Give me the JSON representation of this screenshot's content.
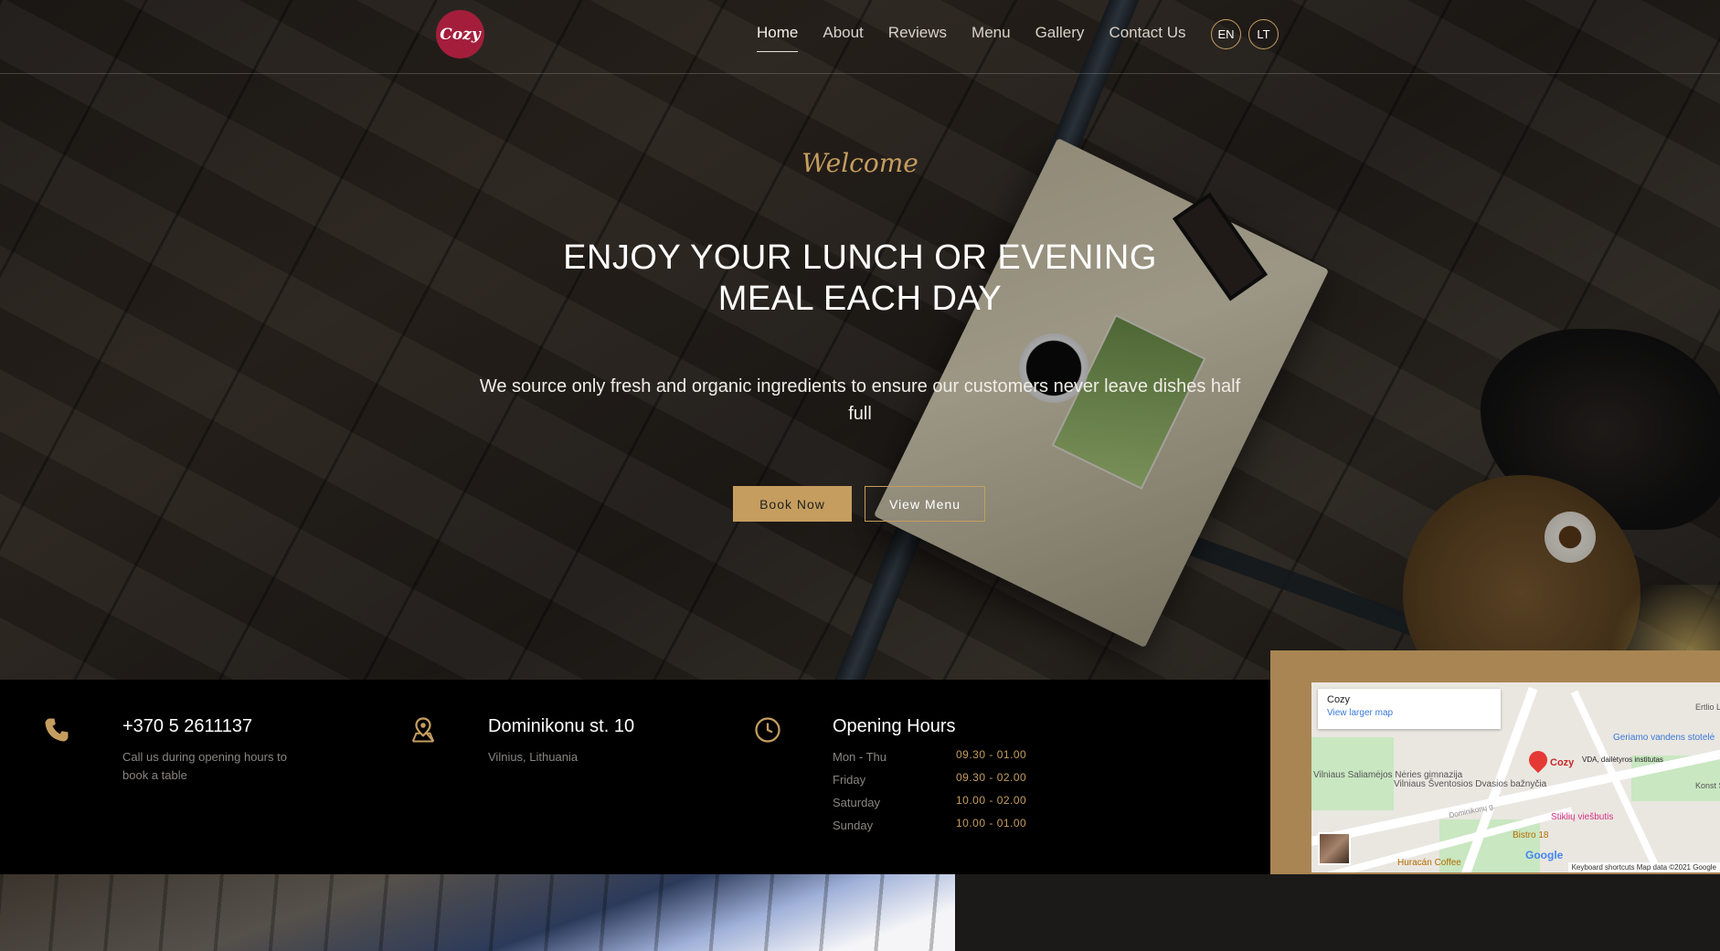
{
  "brand": {
    "logo_text": "Cozy",
    "accent": "#c59d5f",
    "logo_color": "#a41e3c"
  },
  "nav": {
    "items": [
      "Home",
      "About",
      "Reviews",
      "Menu",
      "Gallery",
      "Contact Us"
    ],
    "active": "Home",
    "languages": [
      "EN",
      "LT"
    ]
  },
  "hero": {
    "welcome": "Welcome",
    "headline_line1": "ENJOY YOUR LUNCH OR EVENING",
    "headline_line2": "MEAL EACH DAY",
    "subtext": "We source only fresh and organic ingredients to ensure our customers never leave dishes half full",
    "book_button": "Book Now",
    "menu_button": "View Menu"
  },
  "info": {
    "phone": {
      "icon": "phone-icon",
      "title": "+370 5 2611137",
      "subtitle": "Call us during opening hours to book a table"
    },
    "address": {
      "icon": "map-pin-icon",
      "title": "Dominikonu st. 10",
      "subtitle": "Vilnius, Lithuania"
    },
    "hours": {
      "icon": "clock-icon",
      "title": "Opening Hours",
      "rows": [
        {
          "day": "Mon - Thu",
          "time": "09.30 - 01.00"
        },
        {
          "day": "Friday",
          "time": "09.30 - 02.00"
        },
        {
          "day": "Saturday",
          "time": "10.00 - 02.00"
        },
        {
          "day": "Sunday",
          "time": "10.00 - 01.00"
        }
      ]
    }
  },
  "map": {
    "place_name": "Cozy",
    "larger_map_link": "View larger map",
    "pin_label": "Cozy",
    "labels": [
      "Geriamo vandens stotelė",
      "VDA, dailėtyros institutas",
      "Vilniaus Saliamėjos Nėries gimnazija",
      "Vilniaus Šventosios Dvasios bažnyčia",
      "Stiklių viešbutis",
      "Bistro 18",
      "Huracán Coffee",
      "Dominikonų g.",
      "Ertlio Lithuan",
      "Konst Sirvy skve"
    ],
    "google_logo": "Google",
    "footer": "Keyboard shortcuts   Map data ©2021 Google"
  }
}
